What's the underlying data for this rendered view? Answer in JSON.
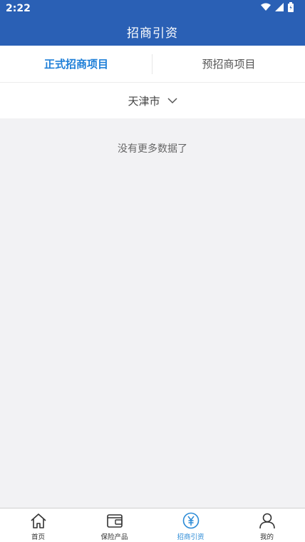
{
  "status_bar": {
    "time": "2:22",
    "icons": [
      "wifi-icon",
      "signal-icon",
      "battery-icon"
    ]
  },
  "header": {
    "title": "招商引资",
    "color": "#2a60b5"
  },
  "tabs": [
    {
      "label": "正式招商项目",
      "active": true
    },
    {
      "label": "预招商项目",
      "active": false
    }
  ],
  "filter": {
    "city": "天津市",
    "icon": "chevron-down-icon"
  },
  "content": {
    "empty_message": "没有更多数据了"
  },
  "bottom_nav": {
    "items": [
      {
        "label": "首页",
        "icon": "home-icon",
        "active": false
      },
      {
        "label": "保险产品",
        "icon": "wallet-icon",
        "active": false
      },
      {
        "label": "招商引资",
        "icon": "yen-icon",
        "active": true
      },
      {
        "label": "我的",
        "icon": "user-icon",
        "active": false
      }
    ],
    "active_color": "#2a8ad6"
  }
}
